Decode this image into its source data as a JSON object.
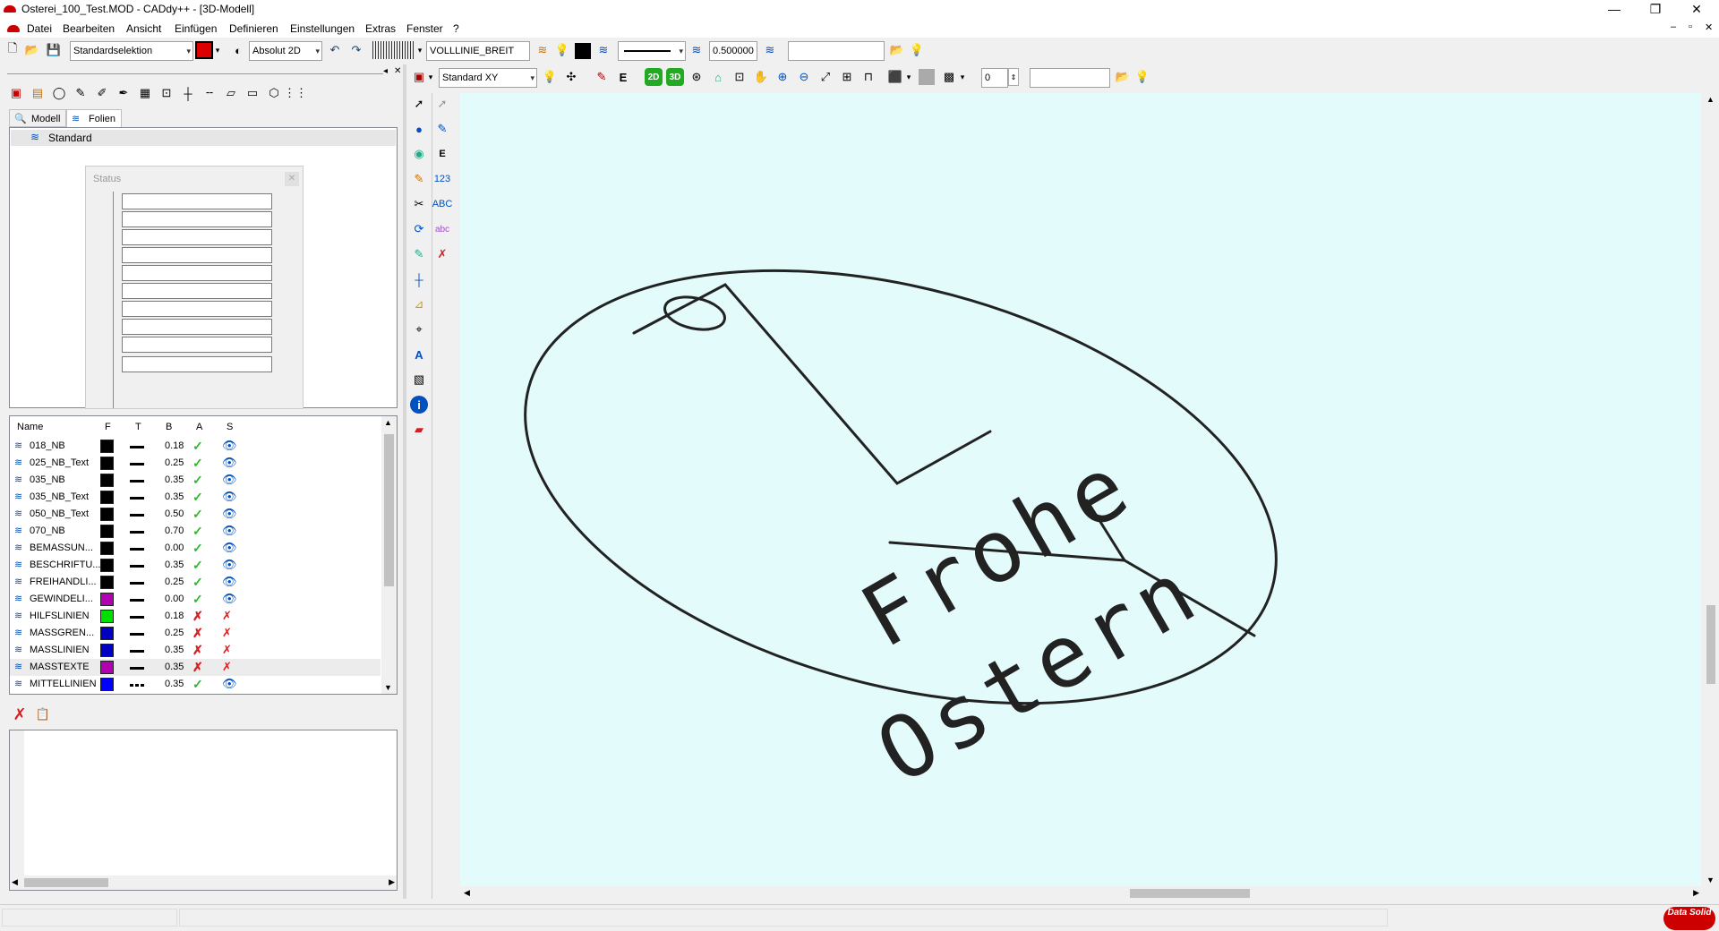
{
  "window": {
    "title": "Osterei_100_Test.MOD  -  CADdy++ - [3D-Modell]",
    "controls": {
      "minimize": "—",
      "restore": "❐",
      "close": "✕"
    },
    "mdi_controls": {
      "minimize": "–",
      "restore": "▫",
      "close": "✕"
    }
  },
  "menu": [
    "Datei",
    "Bearbeiten",
    "Ansicht",
    "Einfügen",
    "Definieren",
    "Einstellungen",
    "Extras",
    "Fenster",
    "?"
  ],
  "toolbar1": {
    "selection_mode": "Standardselektion",
    "coord_mode": "Absolut 2D",
    "linetype": "VOLLLINIE_BREIT",
    "line_width": "0.500000",
    "search_value": ""
  },
  "toolbar2": {
    "view": "Standard XY",
    "btn_2d": "2D",
    "btn_3d": "3D",
    "level": "0",
    "search_value": ""
  },
  "left_panel": {
    "tabs": [
      "Modell",
      "Folien"
    ],
    "active_tab": "Folien",
    "tree_root": "Standard"
  },
  "status_dialog": {
    "title": "Status",
    "close": "✕"
  },
  "layer_table": {
    "headers": [
      "Name",
      "F",
      "T",
      "B",
      "A",
      "S"
    ],
    "rows": [
      {
        "name": "018_NB",
        "color": "#000000",
        "weight": "0.18",
        "active": "✓",
        "visible": "👁"
      },
      {
        "name": "025_NB_Text",
        "color": "#000000",
        "weight": "0.25",
        "active": "✓",
        "visible": "👁"
      },
      {
        "name": "035_NB",
        "color": "#000000",
        "weight": "0.35",
        "active": "✓",
        "visible": "👁"
      },
      {
        "name": "035_NB_Text",
        "color": "#000000",
        "weight": "0.35",
        "active": "✓",
        "visible": "👁"
      },
      {
        "name": "050_NB_Text",
        "color": "#000000",
        "weight": "0.50",
        "active": "✓",
        "visible": "👁"
      },
      {
        "name": "070_NB",
        "color": "#000000",
        "weight": "0.70",
        "active": "✓",
        "visible": "👁"
      },
      {
        "name": "BEMASSUN...",
        "color": "#000000",
        "weight": "0.00",
        "active": "✓",
        "visible": "👁"
      },
      {
        "name": "BESCHRIFTU...",
        "color": "#000000",
        "weight": "0.35",
        "active": "✓",
        "visible": "👁"
      },
      {
        "name": "FREIHANDLI...",
        "color": "#000000",
        "weight": "0.25",
        "active": "✓",
        "visible": "👁"
      },
      {
        "name": "GEWINDELI...",
        "color": "#b000b0",
        "weight": "0.00",
        "active": "✓",
        "visible": "👁"
      },
      {
        "name": "HILFSLINIEN",
        "color": "#00e000",
        "weight": "0.18",
        "active": "✗",
        "visible": "✗"
      },
      {
        "name": "MASSGREN...",
        "color": "#0000c0",
        "weight": "0.25",
        "active": "✗",
        "visible": "✗"
      },
      {
        "name": "MASSLINIEN",
        "color": "#0000c0",
        "weight": "0.35",
        "active": "✗",
        "visible": "✗"
      },
      {
        "name": "MASSTEXTE",
        "color": "#b000b0",
        "weight": "0.35",
        "active": "✗",
        "visible": "✗"
      },
      {
        "name": "MITTELLINIEN",
        "color": "#0000ff",
        "weight": "0.35",
        "active": "✓",
        "visible": "👁"
      }
    ]
  },
  "drawing": {
    "texts": [
      "Frohe",
      "Ostern"
    ],
    "canvas_color": "#e4fbfb"
  },
  "brand": "Data Solid"
}
